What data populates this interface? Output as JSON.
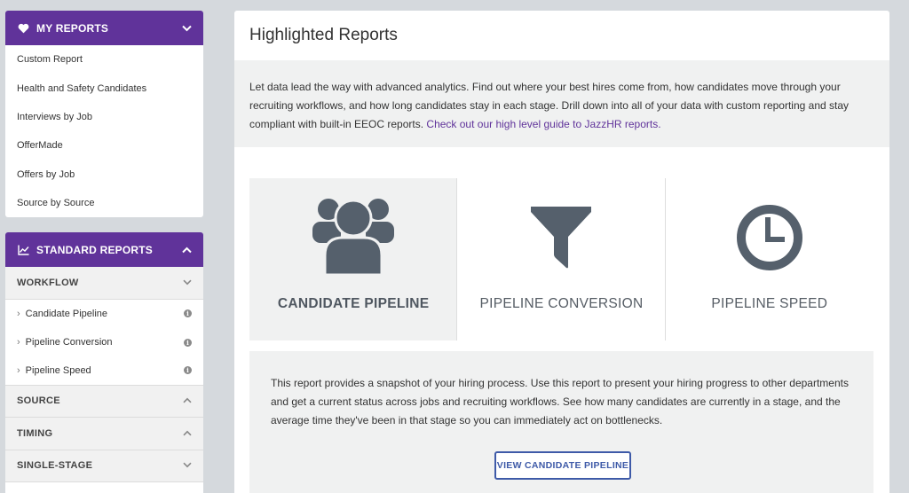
{
  "sidebar": {
    "my_reports": {
      "title": "MY REPORTS",
      "icon": "heart-icon",
      "items": [
        "Custom Report",
        "Health and Safety Candidates",
        "Interviews by Job",
        "OfferMade",
        "Offers by Job",
        "Source by Source"
      ]
    },
    "standard_reports": {
      "title": "STANDARD REPORTS",
      "icon": "chart-line-icon",
      "sections": [
        {
          "label": "WORKFLOW",
          "items": [
            "Candidate Pipeline",
            "Pipeline Conversion",
            "Pipeline Speed"
          ]
        },
        {
          "label": "SOURCE"
        },
        {
          "label": "TIMING"
        },
        {
          "label": "SINGLE-STAGE"
        }
      ]
    }
  },
  "main": {
    "title": "Highlighted Reports",
    "intro_text": "Let data lead the way with advanced analytics. Find out where your best hires come from, how candidates move through your recruiting workflows, and how long candidates stay in each stage. Drill down into all of your data with custom reporting and stay compliant with built-in EEOC reports. ",
    "intro_link": "Check out our high level guide to JazzHR reports.",
    "tiles": [
      {
        "label": "CANDIDATE PIPELINE",
        "icon": "users-group-icon"
      },
      {
        "label": "PIPELINE CONVERSION",
        "icon": "funnel-icon"
      },
      {
        "label": "PIPELINE SPEED",
        "icon": "clock-icon"
      }
    ],
    "description": "This report provides a snapshot of your hiring process. Use this report to present your hiring progress to other departments and get a current status across jobs and recruiting workflows. See how many candidates are currently in a stage, and the average time they've been in that stage so you can immediately act on bottlenecks.",
    "view_button": "VIEW CANDIDATE PIPELINE"
  },
  "colors": {
    "brand_purple": "#60339a",
    "button_blue": "#3e5aa8",
    "icon_gray": "#55606c"
  }
}
